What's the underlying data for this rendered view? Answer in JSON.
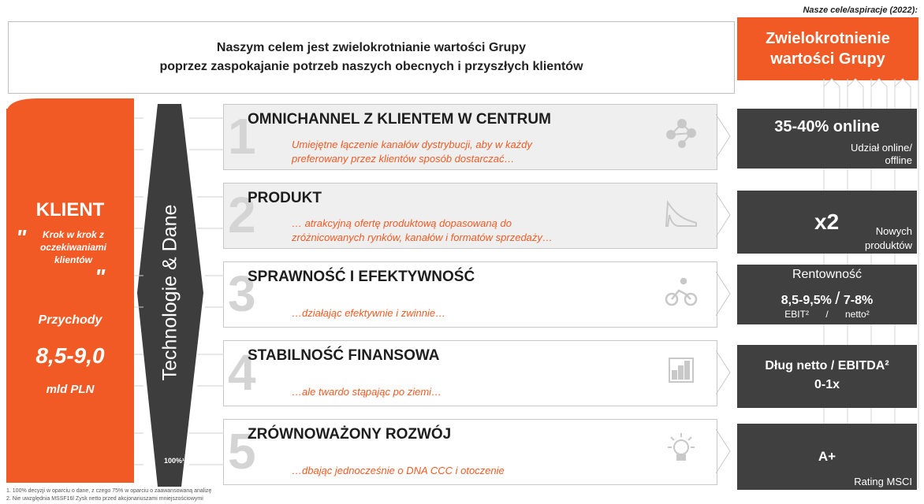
{
  "header": {
    "aspiration_note": "Nasze cele/aspiracje (2022):",
    "mission_line1": "Naszym celem jest zwielokrotnianie wartości Grupy",
    "mission_line2": "poprzez zaspokajanie potrzeb naszych obecnych i przyszłych klientów",
    "goal_line1": "Zwielokrotnienie",
    "goal_line2": "wartości Grupy"
  },
  "klient": {
    "title": "KLIENT",
    "quote_open": "\"",
    "quote": "Krok w krok z oczekiwaniami klientów",
    "quote_close": "\"",
    "revenue_label": "Przychody",
    "revenue_value": "8,5-9,0",
    "revenue_unit": "mld PLN"
  },
  "tech": {
    "label": "Technologie & Dane",
    "percent": "100%¹"
  },
  "pillars": [
    {
      "num": "1",
      "title": "OMNICHANNEL Z KLIENTEM W CENTRUM",
      "desc1": "Umiejętne łączenie kanałów dystrybucji, aby w każdy",
      "desc2": "preferowany przez klientów sposób dostarczać…",
      "icon": "network-icon"
    },
    {
      "num": "2",
      "title": "PRODUKT",
      "desc1": "… atrakcyjną ofertę produktową dopasowaną do",
      "desc2": "zróżnicowanych rynków, kanałów i formatów sprzedaży…",
      "icon": "shoe-icon"
    },
    {
      "num": "3",
      "title": "SPRAWNOŚĆ I EFEKTYWNOŚĆ",
      "desc1": "…działając efektywnie i zwinnie…",
      "desc2": "",
      "icon": "cyclist-icon"
    },
    {
      "num": "4",
      "title": "STABILNOŚĆ FINANSOWA",
      "desc1": "…ale twardo stąpając po ziemi…",
      "desc2": "",
      "icon": "finance-chart-icon"
    },
    {
      "num": "5",
      "title": "ZRÓWNOWAŻONY ROZWÓJ",
      "desc1": "…dbając jednocześnie o DNA CCC i otoczenie",
      "desc2": "",
      "icon": "lightbulb-icon"
    }
  ],
  "kpis": {
    "online_value": "35-40% online",
    "online_sub1": "Udział online/",
    "online_sub2": "offline",
    "product_value": "x2",
    "product_sub1": "Nowych",
    "product_sub2": "produktów",
    "profit_label": "Rentowność",
    "profit_ebit": "8,5-9,5%",
    "profit_slash": "/",
    "profit_net": "7-8%",
    "profit_ebit_label": "EBIT²",
    "profit_sep": "/",
    "profit_net_label": "netto²",
    "debt_line1": "Dług netto / EBITDA²",
    "debt_line2": "0-1x",
    "msci_value": "A+",
    "msci_sub": "Rating MSCI"
  },
  "footnotes": {
    "note1": "1.      100% decyzji w oparciu o dane, z czego 75% w oparciu o zaawansowaną analizę",
    "note2": "2.      Nie uwzględnia MSSF16l Zysk netto przed akcjonariuszami mniejszościowymi"
  },
  "colors": {
    "accent": "#F15A24",
    "dark": "#404040",
    "tech": "#3d3d3d"
  }
}
